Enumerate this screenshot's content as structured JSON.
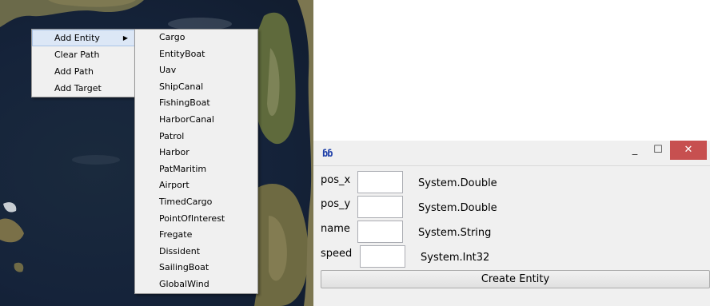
{
  "context_menu": {
    "items": [
      {
        "label": "Add Entity",
        "has_submenu": true,
        "highlighted": true
      },
      {
        "label": "Clear Path"
      },
      {
        "label": "Add Path"
      },
      {
        "label": "Add Target"
      }
    ]
  },
  "submenu": {
    "items": [
      "Cargo",
      "EntityBoat",
      "Uav",
      "ShipCanal",
      "FishingBoat",
      "HarborCanal",
      "Patrol",
      "Harbor",
      "PatMaritim",
      "Airport",
      "TimedCargo",
      "PointOfInterest",
      "Fregate",
      "Dissident",
      "SailingBoat",
      "GlobalWind"
    ]
  },
  "window": {
    "icon": "app-logo-icon",
    "controls": {
      "minimize": "_",
      "maximize": "☐",
      "close": "✕"
    },
    "fields": [
      {
        "label": "pos_x",
        "value": "",
        "type": "System.Double"
      },
      {
        "label": "pos_y",
        "value": "",
        "type": "System.Double"
      },
      {
        "label": "name",
        "value": "",
        "type": "System.String"
      },
      {
        "label": "speed",
        "value": "",
        "type": "System.Int32"
      }
    ],
    "create_button": "Create Entity",
    "close_color": "#c75050"
  }
}
